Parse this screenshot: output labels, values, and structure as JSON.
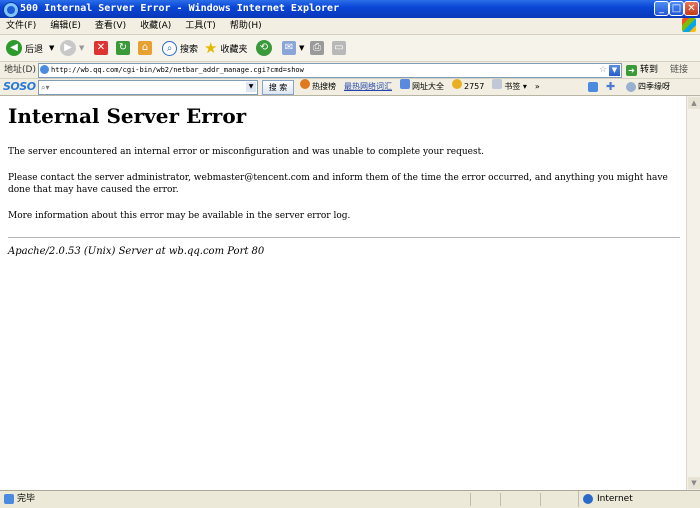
{
  "window": {
    "title": "500 Internal Server Error - Windows Internet Explorer",
    "controls": [
      "minimize",
      "maximize",
      "close"
    ]
  },
  "menubar": {
    "items": [
      "文件(F)",
      "编辑(E)",
      "查看(V)",
      "收藏(A)",
      "工具(T)",
      "帮助(H)"
    ]
  },
  "toolbar": {
    "back_label": "后退",
    "search_label": "搜索",
    "favorites_label": "收藏夹"
  },
  "address": {
    "label": "地址(D)",
    "url": "http://wb.qq.com/cgi-bin/wb2/netbar_addr_manage.cgi?cmd=show",
    "go_label": "转到",
    "links_label": "链接"
  },
  "soso": {
    "logo": "SOSO",
    "search_button": "搜 索",
    "items": [
      "热搜榜",
      "最热网络词汇",
      "网址大全",
      "2757",
      "书签"
    ],
    "more": "»",
    "right_label": "四季缘呀"
  },
  "page": {
    "heading": "Internal Server Error",
    "para1": "The server encountered an internal error or misconfiguration and was unable to complete your request.",
    "para2": "Please contact the server administrator, webmaster@tencent.com and inform them of the time the error occurred, and anything you might have done that may have caused the error.",
    "para3": "More information about this error may be available in the server error log.",
    "address": "Apache/2.0.53 (Unix) Server at wb.qq.com Port 80"
  },
  "status": {
    "text": "完毕",
    "zone": "Internet"
  },
  "colors": {
    "titlebar": "#0a46d6",
    "chrome": "#ece9d8",
    "link": "#2244aa"
  }
}
